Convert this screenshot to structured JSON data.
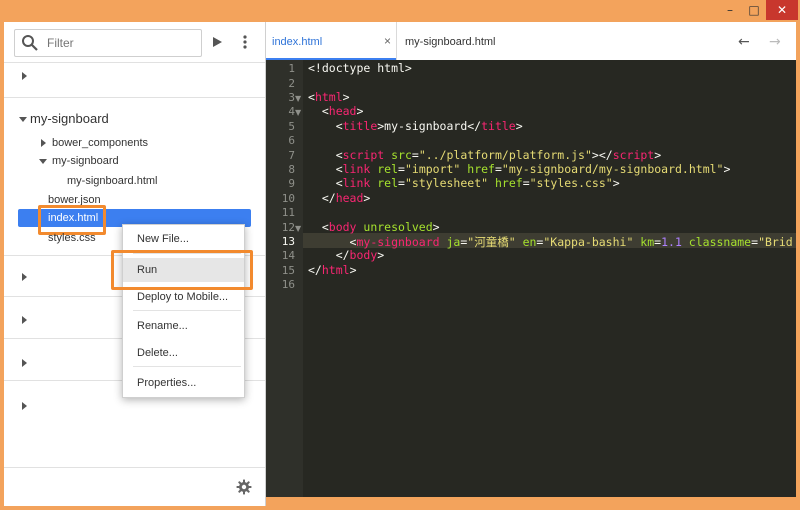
{
  "window": {
    "min": "–",
    "max": "□",
    "close": "✕"
  },
  "sidebar": {
    "search_placeholder": "Filter",
    "project": "my-signboard",
    "tree": {
      "bower_components": "bower_components",
      "my_signboard_folder": "my-signboard",
      "my_signboard_html": "my-signboard.html",
      "bower_json": "bower.json",
      "index_html": "index.html",
      "styles_css": "styles.css"
    }
  },
  "tabs": [
    {
      "label": "index.html",
      "close": "×"
    },
    {
      "label": "my-signboard.html"
    }
  ],
  "nav": {
    "back": "←",
    "forward": "→"
  },
  "context_menu": {
    "new_file": "New File...",
    "run": "Run",
    "deploy": "Deploy to Mobile...",
    "rename": "Rename...",
    "delete": "Delete...",
    "properties": "Properties..."
  },
  "code": {
    "l1": "<!doctype html>",
    "l3a": "<",
    "l3t": "html",
    "l3b": ">",
    "l4a": "  <",
    "l4t": "head",
    "l4b": ">",
    "l5a": "    <",
    "l5t": "title",
    "l5b": ">my-signboard</",
    "l5t2": "title",
    "l5c": ">",
    "l7a": "    <",
    "l7t": "script",
    "l7at": " src",
    "l7eq": "=",
    "l7v": "\"../platform/platform.js\"",
    "l7b": "></",
    "l7t2": "script",
    "l7c": ">",
    "l8a": "    <",
    "l8t": "link",
    "l8at": " rel",
    "l8eq": "=",
    "l8v": "\"import\"",
    "l8at2": " href",
    "l8eq2": "=",
    "l8v2": "\"my-signboard/my-signboard.html\"",
    "l8c": ">",
    "l9a": "    <",
    "l9t": "link",
    "l9at": " rel",
    "l9eq": "=",
    "l9v": "\"stylesheet\"",
    "l9at2": " href",
    "l9eq2": "=",
    "l9v2": "\"styles.css\"",
    "l9c": ">",
    "l10a": "  </",
    "l10t": "head",
    "l10b": ">",
    "l12a": "  <",
    "l12t": "body",
    "l12at": " unresolved",
    "l12b": ">",
    "l13a": "      <",
    "l13t": "my-signboard",
    "l13at": " ja",
    "l13eq": "=",
    "l13v": "\"河童橋\"",
    "l13at2": " en",
    "l13eq2": "=",
    "l13v2": "\"Kappa-bashi\"",
    "l13at3": " km",
    "l13eq3": "=",
    "l13v3": "1.1",
    "l13at4": " classname",
    "l13eq4": "=",
    "l13v4": "\"Brid",
    "l14a": "    </",
    "l14t": "body",
    "l14b": ">",
    "l15a": "</",
    "l15t": "html",
    "l15b": ">"
  }
}
